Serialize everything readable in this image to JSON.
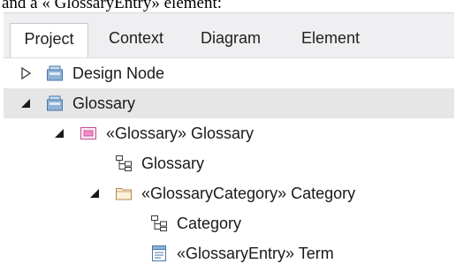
{
  "caption": "and a « GlossaryEntry» element:",
  "tabs": [
    {
      "label": "Project",
      "active": true
    },
    {
      "label": "Context",
      "active": false
    },
    {
      "label": "Diagram",
      "active": false
    },
    {
      "label": "Element",
      "active": false
    }
  ],
  "tree": {
    "rows": [
      {
        "label": "Design Node",
        "icon": "package-icon",
        "toggle": "expand-arrow-icon",
        "selected": false
      },
      {
        "label": "Glossary",
        "icon": "package-icon",
        "toggle": "collapse-arrow-icon",
        "selected": true
      },
      {
        "label": "«Glossary» Glossary",
        "icon": "glossary-model-icon",
        "toggle": "collapse-arrow-icon",
        "selected": false
      },
      {
        "label": "Glossary",
        "icon": "diagram-icon",
        "toggle": "",
        "selected": false
      },
      {
        "label": "«GlossaryCategory» Category",
        "icon": "folder-icon",
        "toggle": "collapse-arrow-icon",
        "selected": false
      },
      {
        "label": "Category",
        "icon": "diagram-icon",
        "toggle": "",
        "selected": false
      },
      {
        "label": "«GlossaryEntry» Term",
        "icon": "glossary-entry-icon",
        "toggle": "",
        "selected": false
      }
    ]
  },
  "colors": {
    "package": "#8fb3d6",
    "package_stroke": "#4a76a8",
    "folder": "#f6e6c8",
    "folder_stroke": "#b08a4a",
    "model_fill": "#f6c8e6",
    "selection": "#e6e6e6"
  }
}
